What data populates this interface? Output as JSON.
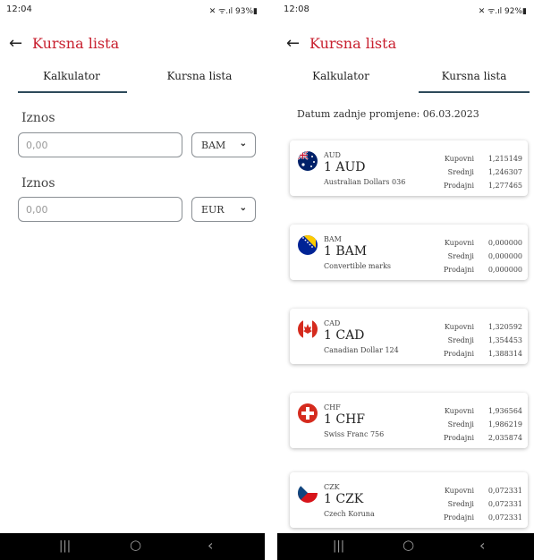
{
  "calculator_screen": {
    "status": {
      "time": "12:04",
      "icons": "✕ ᯤ.ıl 93%▮"
    },
    "title": "Kursna lista",
    "tabs": [
      {
        "label": "Kalkulator",
        "active": true
      },
      {
        "label": "Kursna lista",
        "active": false
      }
    ],
    "amount_1": {
      "label": "Iznos",
      "placeholder": "0,00",
      "currency": "BAM"
    },
    "amount_2": {
      "label": "Iznos",
      "placeholder": "0,00",
      "currency": "EUR"
    },
    "nav": {
      "recents": "|||",
      "home": "○",
      "back": "‹"
    }
  },
  "rates_screen": {
    "status": {
      "time": "12:08",
      "icons": "✕ ᯤ.ıl 92%▮"
    },
    "title": "Kursna lista",
    "tabs": [
      {
        "label": "Kalkulator",
        "active": false
      },
      {
        "label": "Kursna lista",
        "active": true
      }
    ],
    "date_line": "Datum zadnje promjene:  06.03.2023",
    "rate_labels": {
      "buy": "Kupovni",
      "mid": "Srednji",
      "sell": "Prodajni"
    },
    "currencies": [
      {
        "code": "AUD",
        "unit": "1 AUD",
        "name": "Australian Dollars 036",
        "buy": "1,215149",
        "mid": "1,246307",
        "sell": "1,277465",
        "flag": "australia-flag"
      },
      {
        "code": "BAM",
        "unit": "1 BAM",
        "name": "Convertible marks",
        "buy": "0,000000",
        "mid": "0,000000",
        "sell": "0,000000",
        "flag": "bosnia-flag"
      },
      {
        "code": "CAD",
        "unit": "1 CAD",
        "name": "Canadian Dollar 124",
        "buy": "1,320592",
        "mid": "1,354453",
        "sell": "1,388314",
        "flag": "canada-flag"
      },
      {
        "code": "CHF",
        "unit": "1 CHF",
        "name": "Swiss Franc 756",
        "buy": "1,936564",
        "mid": "1,986219",
        "sell": "2,035874",
        "flag": "switzerland-flag"
      },
      {
        "code": "CZK",
        "unit": "1 CZK",
        "name": "Czech Koruna",
        "buy": "0,072331",
        "mid": "0,072331",
        "sell": "0,072331",
        "flag": "czech-flag"
      }
    ],
    "nav": {
      "recents": "|||",
      "home": "○",
      "back": "‹"
    }
  },
  "colors": {
    "accent": "#c8202f",
    "tab_indicator": "#2d4a5a",
    "navbar": "#000000"
  }
}
